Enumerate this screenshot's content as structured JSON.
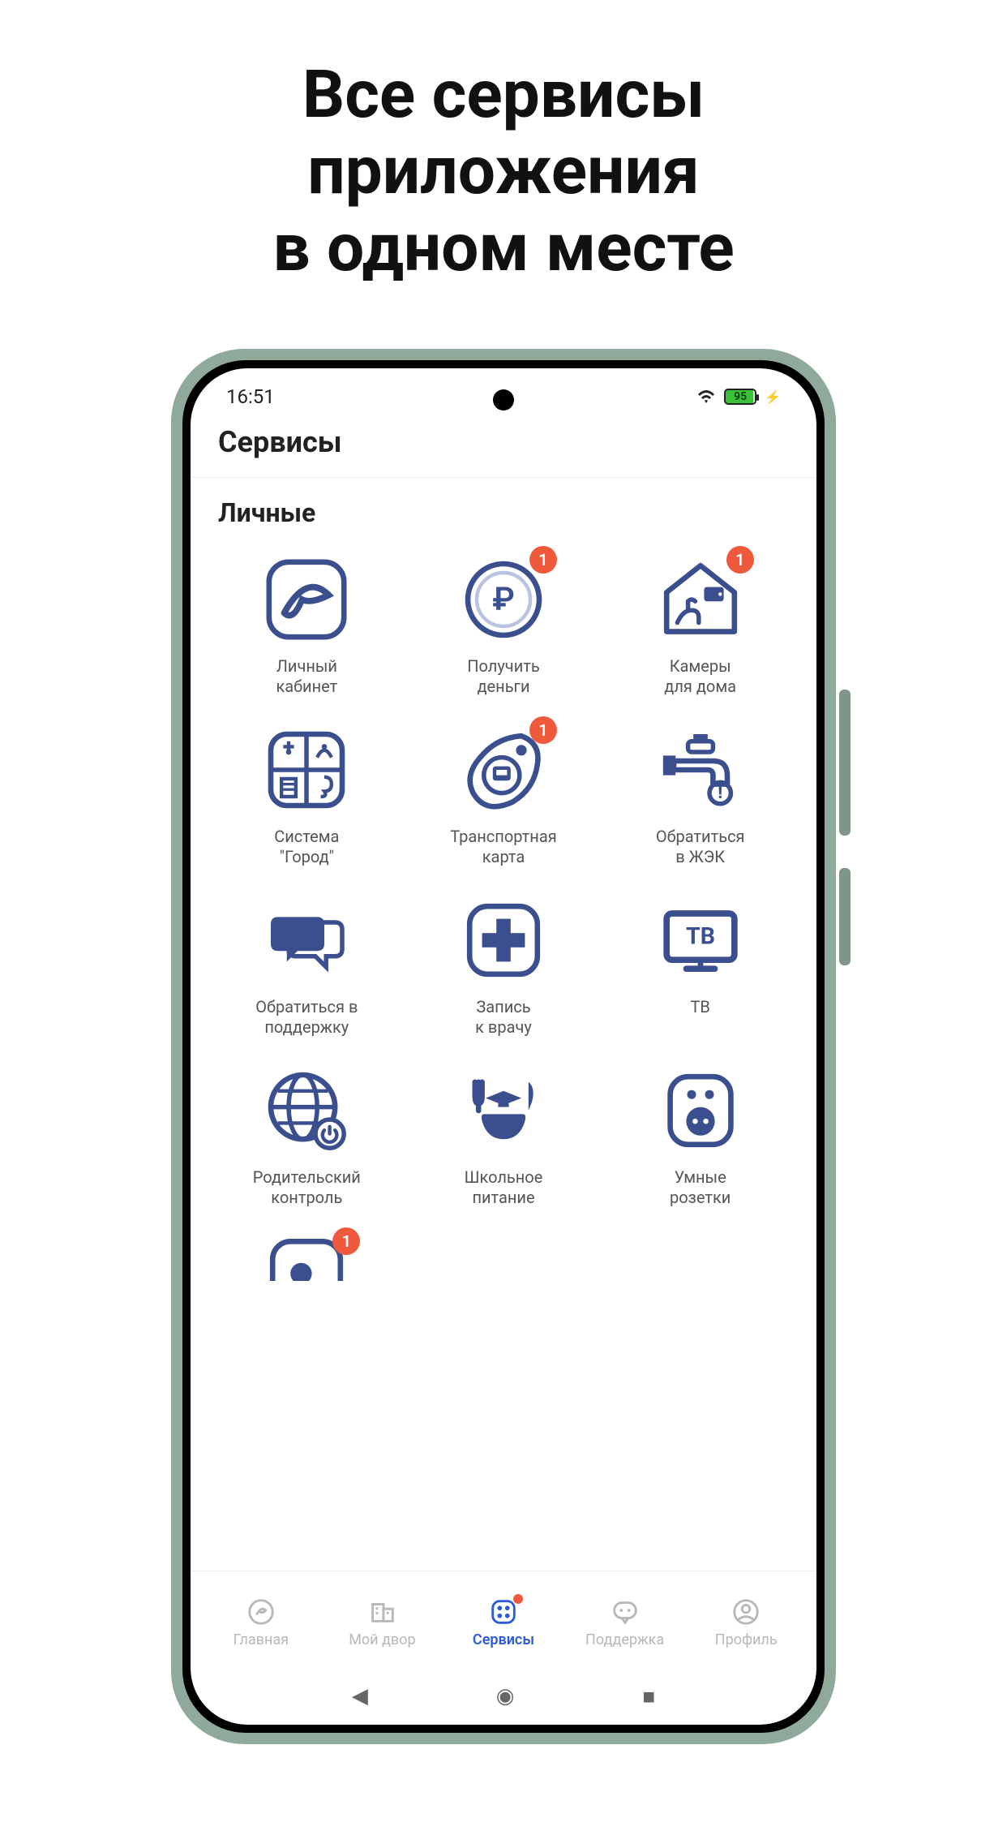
{
  "promo_headline": "Все сервисы\nприложения\nв одном месте",
  "statusbar": {
    "time": "16:51",
    "battery": "95"
  },
  "header": {
    "title": "Сервисы"
  },
  "section": {
    "title": "Личные"
  },
  "colors": {
    "accent": "#3b4f8f",
    "badge": "#f05a3c",
    "nav_active": "#2b5bd7"
  },
  "services": [
    {
      "label": "Личный\nкабинет",
      "icon": "account-s",
      "badge": null
    },
    {
      "label": "Получить\nденьги",
      "icon": "ruble-coin",
      "badge": "1"
    },
    {
      "label": "Камеры\nдля дома",
      "icon": "home-camera",
      "badge": "1"
    },
    {
      "label": "Система\n\"Город\"",
      "icon": "city-grid",
      "badge": null
    },
    {
      "label": "Транспортная\nкарта",
      "icon": "transport-card",
      "badge": "1"
    },
    {
      "label": "Обратиться\nв ЖЭК",
      "icon": "faucet-alert",
      "badge": null
    },
    {
      "label": "Обратиться в\nподдержку",
      "icon": "chat-question",
      "badge": null
    },
    {
      "label": "Запись\nк врачу",
      "icon": "medical-plus",
      "badge": null
    },
    {
      "label": "ТВ",
      "icon": "tv",
      "badge": null
    },
    {
      "label": "Родительский\nконтроль",
      "icon": "globe-power",
      "badge": null
    },
    {
      "label": "Школьное\nпитание",
      "icon": "school-meal",
      "badge": null
    },
    {
      "label": "Умные\nрозетки",
      "icon": "smart-socket",
      "badge": null
    },
    {
      "label": "",
      "icon": "partial",
      "badge": "1"
    }
  ],
  "nav": [
    {
      "label": "Главная",
      "icon": "home-nav",
      "active": false,
      "dot": false
    },
    {
      "label": "Мой двор",
      "icon": "yard-nav",
      "active": false,
      "dot": false
    },
    {
      "label": "Сервисы",
      "icon": "services-nav",
      "active": true,
      "dot": true
    },
    {
      "label": "Поддержка",
      "icon": "support-nav",
      "active": false,
      "dot": false
    },
    {
      "label": "Профиль",
      "icon": "profile-nav",
      "active": false,
      "dot": false
    }
  ]
}
